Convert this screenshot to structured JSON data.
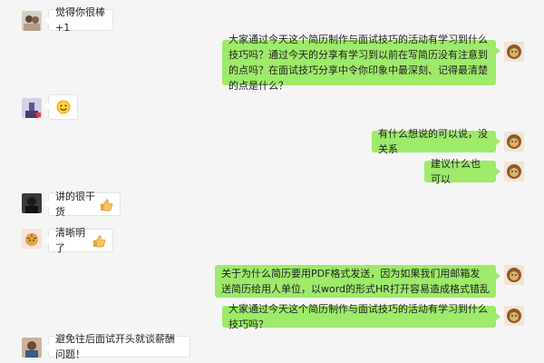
{
  "messages": [
    {
      "side": "left",
      "text": "觉得你很棒+1",
      "avatar": "avatar-couple-icon"
    },
    {
      "side": "right",
      "text": "大家通过今天这个简历制作与面试技巧的活动有学习到什么技巧吗？通过今天的分享有学习到以前在写简历没有注意到的点吗？在面试技巧分享中令你印象中最深刻、记得最清楚的点是什么？",
      "avatar": "avatar-lion-icon"
    },
    {
      "side": "left",
      "text": "",
      "emoji": "smiley-emoji-icon",
      "avatar": "avatar-purple-icon"
    },
    {
      "side": "right",
      "text": "有什么想说的可以说，没关系",
      "avatar": "avatar-lion-icon"
    },
    {
      "side": "right",
      "text": "建议什么也可以",
      "avatar": "avatar-lion-icon"
    },
    {
      "side": "left",
      "text": "讲的很干货",
      "emoji": "thumbs-up-icon",
      "avatar": "avatar-dark-icon"
    },
    {
      "side": "left",
      "text": "清晰明了",
      "emoji": "thumbs-up-icon",
      "avatar": "avatar-tiger-icon"
    },
    {
      "side": "right",
      "text": "关于为什么简历要用PDF格式发送，因为如果我们用邮箱发送简历给用人单位，以word的形式HR打开容易造成格式错乱",
      "avatar": "avatar-lion-icon"
    },
    {
      "side": "right",
      "text": "大家通过今天这个简历制作与面试技巧的活动有学习到什么技巧吗？",
      "avatar": "avatar-lion-icon"
    },
    {
      "side": "left",
      "text": "避免往后面试开头就谈薪酬问题！",
      "avatar": "avatar-boy-icon"
    }
  ],
  "colors": {
    "background": "#f5f5f5",
    "right_bubble": "#9eea6a",
    "left_bubble": "#ffffff"
  }
}
